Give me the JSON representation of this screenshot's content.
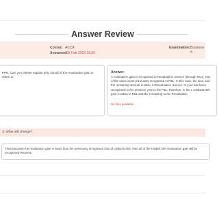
{
  "page": {
    "title": "Answer Review"
  },
  "info": {
    "course_label": "Course:",
    "course_value": "ACCA",
    "answered_label": "Answered:",
    "answered_value": "02 Feb 2023 15:26",
    "examination_label": "Examination:",
    "examination_value": "Business a"
  },
  "question": {
    "text": "PPE. Can you please explain why not all of the revaluation gain is taken to"
  },
  "answer": {
    "heading": "Answer:",
    "text": "A revaluation gain is recognised to Revaluation reserve (through OCI), loss of the same asset previously recognised in P&L. In this case, the loss, and the remaining amount is taken to Revaluation reserve. In your has been recognised in the previous year in the P&L; therefore, in the c US$100,000 gain is taken to P&L and the remaining to the Revaluation",
    "extra": "No files available"
  },
  "followup": {
    "text": "3: What will change?"
  },
  "reply": {
    "text": "Then because the revaluation gain is lower than the previously recognised loss of US$100,000, then all of the US$80,000 revaluation gain will be recognised Reserve."
  },
  "colors": {
    "accent": "#e0402b",
    "band": "#fbece6"
  }
}
